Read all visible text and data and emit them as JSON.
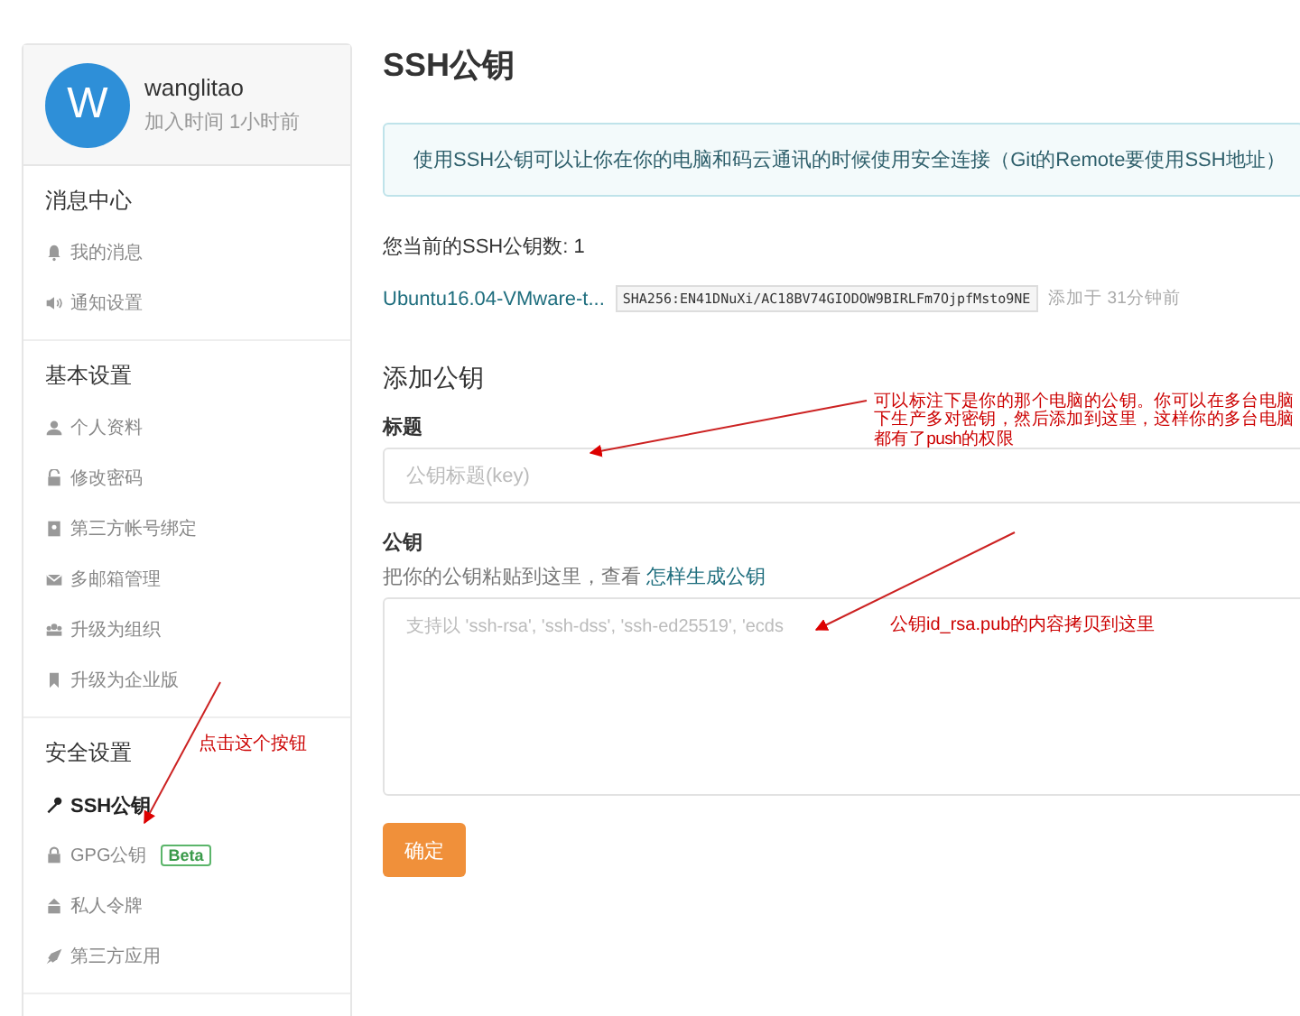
{
  "profile": {
    "avatar_letter": "W",
    "name": "wanglitao",
    "joined": "加入时间 1小时前"
  },
  "sidebar": {
    "sections": [
      {
        "title": "消息中心",
        "items": [
          {
            "label": "我的消息",
            "selected": false
          },
          {
            "label": "通知设置",
            "selected": false
          }
        ]
      },
      {
        "title": "基本设置",
        "items": [
          {
            "label": "个人资料",
            "selected": false
          },
          {
            "label": "修改密码",
            "selected": false
          },
          {
            "label": "第三方帐号绑定",
            "selected": false
          },
          {
            "label": "多邮箱管理",
            "selected": false
          },
          {
            "label": "升级为组织",
            "selected": false
          },
          {
            "label": "升级为企业版",
            "selected": false
          }
        ]
      },
      {
        "title": "安全设置",
        "items": [
          {
            "label": "SSH公钥",
            "selected": true
          },
          {
            "label": "GPG公钥",
            "selected": false,
            "badge": "Beta"
          },
          {
            "label": "私人令牌",
            "selected": false
          },
          {
            "label": "第三方应用",
            "selected": false
          }
        ]
      }
    ]
  },
  "page": {
    "title": "SSH公钥",
    "notice": "使用SSH公钥可以让你在你的电脑和码云通讯的时候使用安全连接（Git的Remote要使用SSH地址）",
    "key_count": "您当前的SSH公钥数: 1",
    "keys": [
      {
        "name": "Ubuntu16.04-VMware-t...",
        "fingerprint": "SHA256:EN41DNuXi/AC18BV74GIODOW9BIRLFm7OjpfMsto9NE",
        "added": "添加于 31分钟前"
      }
    ],
    "add_title": "添加公钥",
    "title_field": {
      "label": "标题",
      "placeholder": "公钥标题(key)"
    },
    "key_field": {
      "label": "公钥",
      "hint": "把你的公钥粘贴到这里，查看 ",
      "hint_link": "怎样生成公钥",
      "placeholder": "支持以 'ssh-rsa', 'ssh-dss', 'ssh-ed25519', 'ecds"
    },
    "submit": "确定"
  },
  "annotations": [
    {
      "text": "可以标注下是你的那个电脑的公钥。你可以在多台电脑下生产多对密钥，然后添加到这里，这样你的多台电脑都有了push的权限"
    },
    {
      "text": "公钥id_rsa.pub的内容拷贝到这里"
    },
    {
      "text": "点击这个按钮"
    }
  ]
}
